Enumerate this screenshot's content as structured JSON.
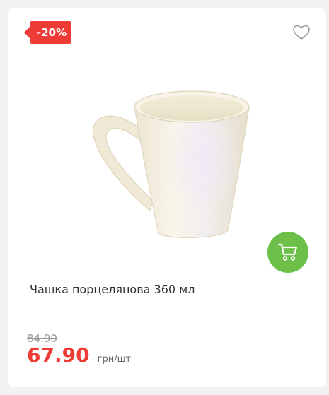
{
  "product": {
    "discount_badge": "-20%",
    "title": "Чашка порцелянова 360 мл",
    "old_price": "84.90",
    "price": "67.90",
    "unit": "грн/шт",
    "image": "white porcelain mug",
    "icons": {
      "wishlist": "heart-outline-icon",
      "cart": "shopping-cart-icon"
    }
  },
  "colors": {
    "badge": "#ee3b35",
    "price": "#ee3b35",
    "cart_button": "#6cc04a",
    "old_price": "#9a9a9a"
  }
}
